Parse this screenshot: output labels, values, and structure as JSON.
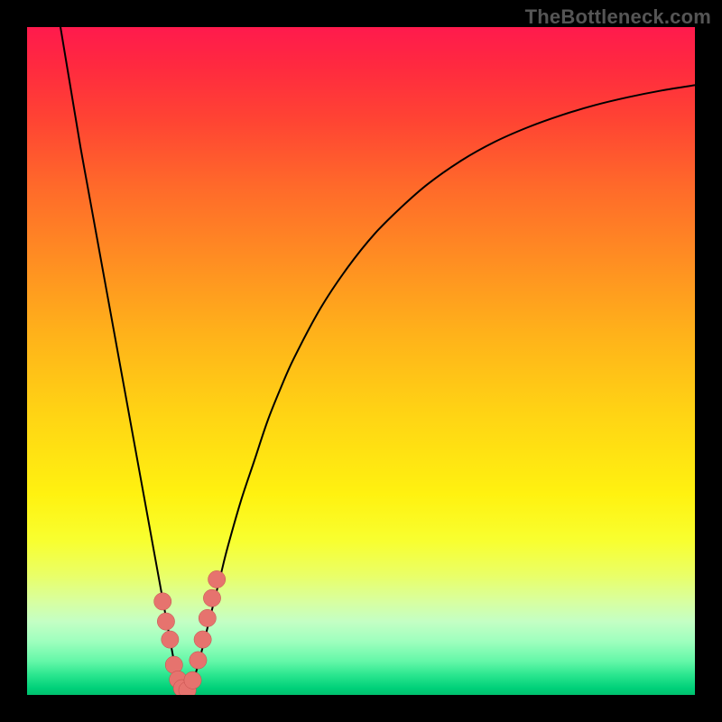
{
  "watermark": "TheBottleneck.com",
  "colors": {
    "curve_stroke": "#000000",
    "marker_fill": "#e6736e",
    "marker_stroke": "#c24d4a"
  },
  "chart_data": {
    "type": "line",
    "title": "",
    "xlabel": "",
    "ylabel": "",
    "xlim": [
      0,
      100
    ],
    "ylim": [
      0,
      100
    ],
    "grid": false,
    "legend": false,
    "series": [
      {
        "name": "bottleneck-curve",
        "x": [
          5,
          6,
          7,
          8,
          9,
          10,
          11,
          12,
          13,
          14,
          15,
          16,
          17,
          18,
          19,
          20,
          21,
          22,
          22.5,
          23,
          23.5,
          24,
          25,
          26,
          27,
          28,
          29,
          30,
          32,
          34,
          36,
          38,
          40,
          44,
          48,
          52,
          56,
          60,
          65,
          70,
          75,
          80,
          85,
          90,
          95,
          100
        ],
        "y": [
          100,
          94,
          88,
          82,
          76.5,
          71,
          65.5,
          60,
          54.5,
          49,
          43.5,
          38,
          32.5,
          27,
          21.5,
          16,
          10.5,
          5,
          2.5,
          1,
          0.4,
          0.6,
          2.5,
          6,
          10,
          14,
          18,
          22,
          29,
          35,
          41,
          46,
          50.5,
          58,
          64,
          69,
          73,
          76.5,
          80,
          82.8,
          85,
          86.8,
          88.3,
          89.5,
          90.5,
          91.3
        ]
      }
    ],
    "markers": {
      "name": "highlight-dots",
      "x": [
        20.3,
        20.8,
        21.4,
        22.0,
        22.6,
        23.2,
        24.0,
        24.8,
        25.6,
        26.3,
        27.0,
        27.7,
        28.4
      ],
      "y": [
        14.0,
        11.0,
        8.3,
        4.5,
        2.3,
        1.0,
        0.7,
        2.2,
        5.2,
        8.3,
        11.5,
        14.5,
        17.3
      ],
      "radius": 1.3
    }
  }
}
